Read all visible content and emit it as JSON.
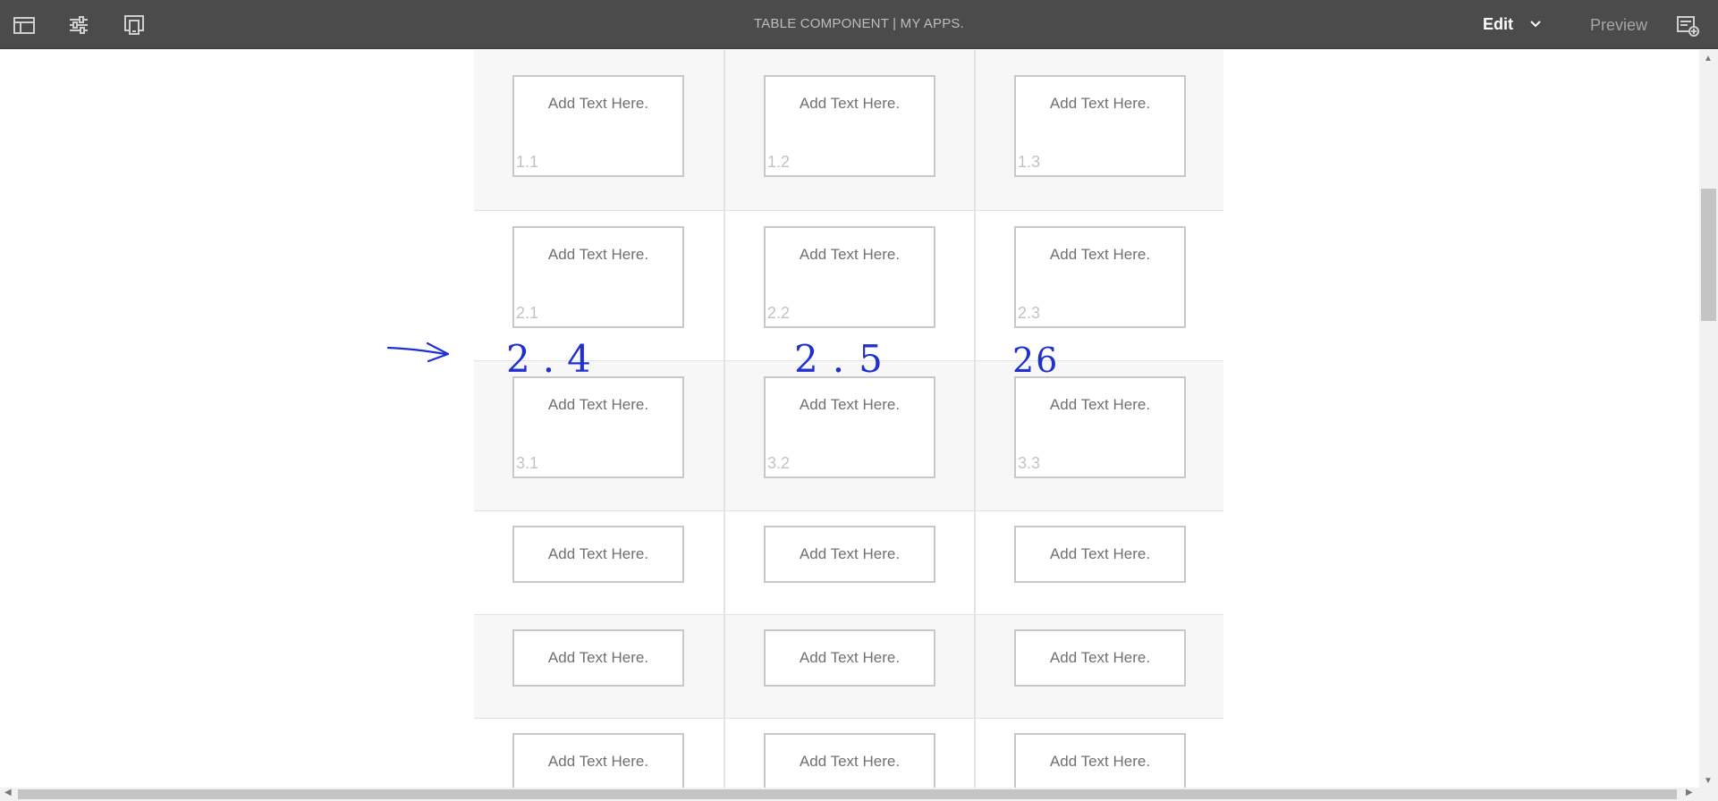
{
  "header": {
    "title": "TABLE COMPONENT | MY APPS.",
    "mode_edit": "Edit",
    "mode_preview": "Preview",
    "icons": [
      "side-panel-icon",
      "page-properties-icon",
      "emulator-icon",
      "annotations-icon"
    ]
  },
  "table": {
    "placeholder": "Add Text Here.",
    "rows": [
      [
        "1.1",
        "1.2",
        "1.3"
      ],
      [
        "2.1",
        "2.2",
        "2.3"
      ],
      [
        "3.1",
        "3.2",
        "3.3"
      ],
      [
        "",
        "",
        ""
      ],
      [
        "",
        "",
        ""
      ],
      [
        "",
        "",
        ""
      ]
    ]
  },
  "annotation": {
    "labels": [
      "2.4",
      "2.5",
      "26"
    ],
    "color": "#1f2fd0"
  }
}
